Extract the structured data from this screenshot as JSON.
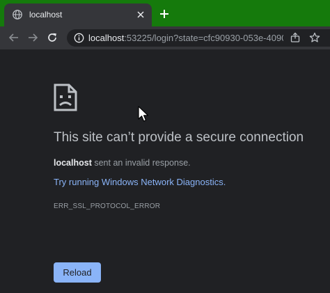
{
  "tab": {
    "title": "localhost",
    "favicon": "globe-icon",
    "close_icon": "close-icon"
  },
  "new_tab_icon": "plus-icon",
  "toolbar": {
    "back_icon": "arrow-left-icon",
    "forward_icon": "arrow-right-icon",
    "reload_icon": "reload-icon",
    "site_info_icon": "info-icon",
    "share_icon": "share-icon",
    "bookmark_icon": "star-icon"
  },
  "omnibox": {
    "host": "localhost",
    "rest": ":53225/login?state=cfc90930-053e-4090-..."
  },
  "error": {
    "icon": "sad-page-icon",
    "title": "This site can’t provide a secure connection",
    "host": "localhost",
    "description": " sent an invalid response.",
    "link": "Try running Windows Network Diagnostics.",
    "code": "ERR_SSL_PROTOCOL_ERROR",
    "reload_label": "Reload"
  },
  "colors": {
    "tabstrip": "#157a0c",
    "toolbar": "#35363a",
    "page_bg": "#202124",
    "link": "#8ab4f8",
    "button": "#8ab4f8"
  }
}
